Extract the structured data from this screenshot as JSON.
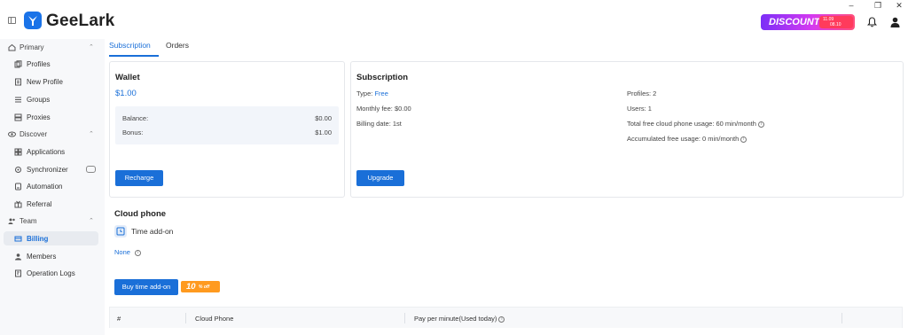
{
  "app": {
    "name": "GeeLark"
  },
  "promo": {
    "label": "DISCOUNT",
    "date_line1": "11.09",
    "date_line2": "08.10"
  },
  "sidebar": {
    "items": [
      {
        "label": "Primary",
        "type": "group",
        "icon": "home-icon"
      },
      {
        "label": "Profiles",
        "type": "item",
        "icon": "profiles-icon"
      },
      {
        "label": "New Profile",
        "type": "item",
        "icon": "new-profile-icon"
      },
      {
        "label": "Groups",
        "type": "item",
        "icon": "groups-icon"
      },
      {
        "label": "Proxies",
        "type": "item",
        "icon": "proxies-icon"
      },
      {
        "label": "Discover",
        "type": "group",
        "icon": "discover-icon"
      },
      {
        "label": "Applications",
        "type": "item",
        "icon": "applications-icon"
      },
      {
        "label": "Synchronizer",
        "type": "item",
        "icon": "synchronizer-icon"
      },
      {
        "label": "Automation",
        "type": "item",
        "icon": "automation-icon"
      },
      {
        "label": "Referral",
        "type": "item",
        "icon": "referral-icon"
      },
      {
        "label": "Team",
        "type": "group",
        "icon": "team-icon"
      },
      {
        "label": "Billing",
        "type": "item",
        "icon": "billing-icon",
        "active": true
      },
      {
        "label": "Members",
        "type": "item",
        "icon": "members-icon"
      },
      {
        "label": "Operation Logs",
        "type": "item",
        "icon": "operation-logs-icon"
      }
    ]
  },
  "tabs": [
    {
      "label": "Subscription",
      "active": true
    },
    {
      "label": "Orders",
      "active": false
    }
  ],
  "wallet": {
    "title": "Wallet",
    "amount": "$1.00",
    "balance_label": "Balance:",
    "balance_value": "$0.00",
    "bonus_label": "Bonus:",
    "bonus_value": "$1.00",
    "recharge_label": "Recharge"
  },
  "subscription": {
    "title": "Subscription",
    "type_label": "Type:",
    "type_value": "Free",
    "monthly_fee": "Monthly fee: $0.00",
    "billing_date": "Billing date: 1st",
    "profiles": "Profiles: 2",
    "users": "Users: 1",
    "total_free_usage": "Total free cloud phone usage: 60 min/month",
    "accumulated_usage": "Accumulated free usage: 0 min/month",
    "upgrade_label": "Upgrade"
  },
  "cloud_phone": {
    "title": "Cloud phone",
    "addon_label": "Time add-on",
    "none_label": "None",
    "buy_label": "Buy time add-on",
    "discount_value": "10",
    "discount_suffix": "% off"
  },
  "table": {
    "columns": [
      "#",
      "Cloud Phone",
      "Pay per minute(Used today)"
    ]
  },
  "colors": {
    "accent": "#1a6fd8",
    "promo_start": "#7b2ff7",
    "promo_end": "#ff4f7b",
    "discount_tag": "#ff9a1f"
  }
}
